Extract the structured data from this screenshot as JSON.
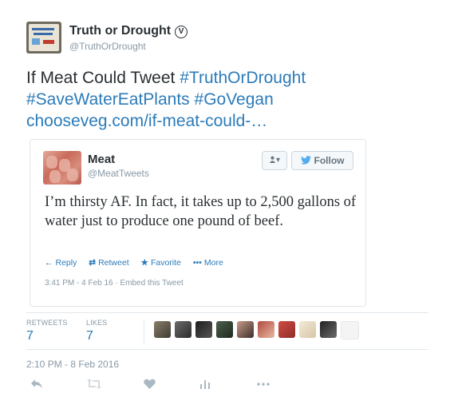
{
  "author": {
    "name": "Truth or Drought",
    "handle": "@TruthOrDrought",
    "verified_glyph": "V"
  },
  "tweet": {
    "text_plain": "If Meat Could Tweet ",
    "hashtag_1": "#TruthOrDrought",
    "hashtag_2": "#SaveWaterEatPlants",
    "hashtag_3": "#GoVegan",
    "link": "chooseveg.com/if-meat-could-…"
  },
  "embedded": {
    "name": "Meat",
    "handle": "@MeatTweets",
    "person_glyph": "▾",
    "follow_label": "Follow",
    "text": "I’m thirsty AF. In fact, it takes up to 2,500 gallons of water just to produce one pound of beef.",
    "actions": {
      "reply": "Reply",
      "retweet": "Retweet",
      "favorite": "Favorite",
      "more": "More"
    },
    "timestamp": "3:41 PM - 4 Feb 16 · Embed this Tweet"
  },
  "stats": {
    "retweets_label": "RETWEETS",
    "retweets_value": "7",
    "likes_label": "LIKES",
    "likes_value": "7"
  },
  "date": "2:10 PM - 8 Feb 2016",
  "icons": {
    "reply": "reply-icon",
    "retweet": "retweet-icon",
    "like": "heart-icon",
    "analytics": "analytics-icon",
    "more": "more-icon"
  },
  "colors": {
    "link": "#2b7bb9",
    "muted": "#8899a6",
    "text": "#292f33",
    "twitter_blue": "#55acee"
  }
}
